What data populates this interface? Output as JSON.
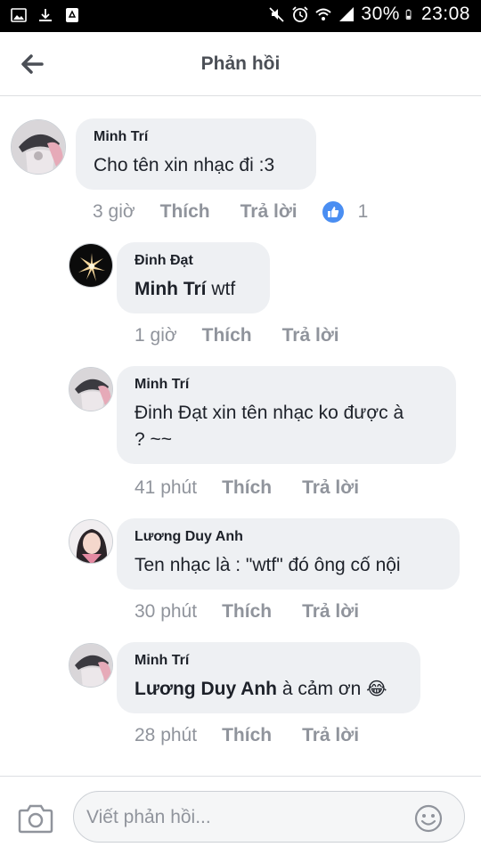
{
  "status_bar": {
    "battery": "30%",
    "time": "23:08"
  },
  "header": {
    "title": "Phản hồi"
  },
  "comments": [
    {
      "author": "Minh Trí",
      "text": "Cho tên xin nhạc đi :3",
      "time": "3 giờ",
      "like": "Thích",
      "reply": "Trả lời",
      "reaction_count": "1"
    },
    {
      "author": "Đinh Đạt",
      "mention": "Minh Trí",
      "text": " wtf",
      "time": "1 giờ",
      "like": "Thích",
      "reply": "Trả lời"
    },
    {
      "author": "Minh Trí",
      "text_line1": "Đinh Đạt xin tên nhạc ko được à",
      "text_line2": "? ~~",
      "time": "41 phút",
      "like": "Thích",
      "reply": "Trả lời"
    },
    {
      "author": "Lương Duy Anh",
      "text": "Ten nhạc là : \"wtf\" đó ông cố nội",
      "time": "30 phút",
      "like": "Thích",
      "reply": "Trả lời"
    },
    {
      "author": "Minh Trí",
      "mention": "Lương Duy Anh",
      "text": " à cảm ơn",
      "emoji": "😂",
      "time": "28 phút",
      "like": "Thích",
      "reply": "Trả lời"
    }
  ],
  "composer": {
    "placeholder": "Viết phản hồi..."
  },
  "colors": {
    "accent_blue": "#4a8ef2",
    "bubble_bg": "#eef0f3",
    "meta_gray": "#90949c"
  }
}
